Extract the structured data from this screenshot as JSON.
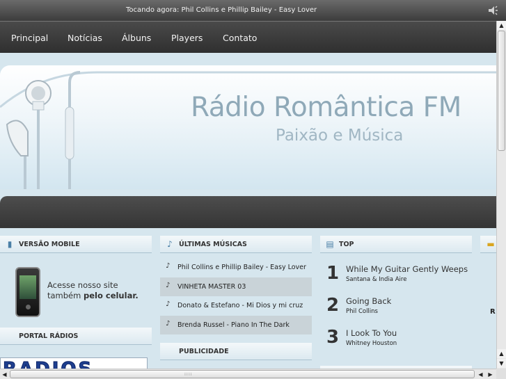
{
  "now_playing": {
    "text": "Tocando agora: Phil Collins e Phillip Bailey - Easy Lover",
    "volume_icon": "speaker-icon"
  },
  "nav": {
    "items": [
      "Principal",
      "Notícias",
      "Álbuns",
      "Players",
      "Contato"
    ]
  },
  "banner": {
    "title": "Rádio Romântica FM",
    "subtitle": "Paixão e Música"
  },
  "mobile": {
    "heading": "VERSÃO MOBILE",
    "text_prefix": "Acesse nosso site também ",
    "text_bold": "pelo celular."
  },
  "portal": {
    "heading": "PORTAL RÁDIOS",
    "banner_text": "RADIOS"
  },
  "latest": {
    "heading": "ÚLTIMAS MÚSICAS",
    "songs": [
      "Phil Collins e Phillip Bailey - Easy Lover",
      "VINHETA MASTER 03",
      "Donato & Estefano - Mi Dios y mi cruz",
      "Brenda Russel - Piano In The Dark"
    ]
  },
  "ads": {
    "heading": "PUBLICIDADE"
  },
  "top": {
    "heading": "TOP",
    "items": [
      {
        "rank": "1",
        "song": "While My Guitar Gently Weeps",
        "artist": "Santana & India Aire"
      },
      {
        "rank": "2",
        "song": "Going Back",
        "artist": "Phil Collins"
      },
      {
        "rank": "3",
        "song": "I Look To You",
        "artist": "Whitney Houston"
      }
    ]
  },
  "partial_column": {
    "letter": "R"
  }
}
